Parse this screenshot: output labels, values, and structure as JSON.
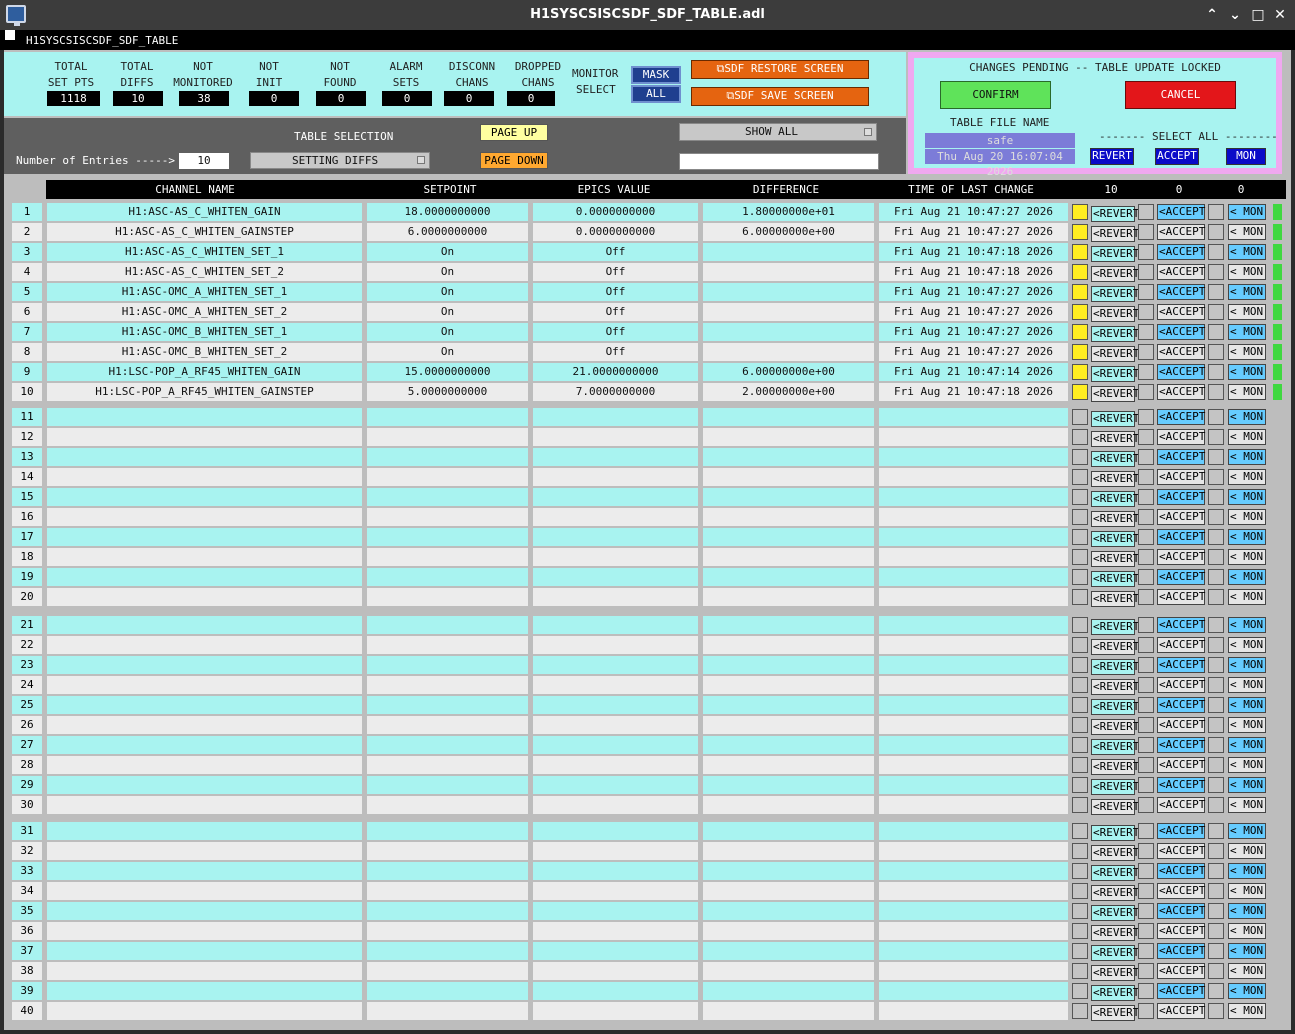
{
  "window": {
    "title": "H1SYSCSISCSDF_SDF_TABLE.adl",
    "minimize": "⌃",
    "restore": "⌄",
    "maximize": "□",
    "close": "✕"
  },
  "menubar": {
    "label": "H1SYSCSISCSDF_SDF_TABLE"
  },
  "stats": [
    {
      "label1": "TOTAL",
      "label2": "SET PTS",
      "value": "1118"
    },
    {
      "label1": "TOTAL",
      "label2": "DIFFS",
      "value": "10"
    },
    {
      "label1": "NOT",
      "label2": "MONITORED",
      "value": "38"
    },
    {
      "label1": "NOT",
      "label2": "INIT",
      "value": "0"
    },
    {
      "label1": "NOT",
      "label2": "FOUND",
      "value": "0"
    },
    {
      "label1": "ALARM",
      "label2": "SETS",
      "value": "0"
    },
    {
      "label1": "DISCONN",
      "label2": "CHANS",
      "value": "0"
    },
    {
      "label1": "DROPPED",
      "label2": "CHANS",
      "value": "0"
    }
  ],
  "monitor_select": {
    "label1": "MONITOR",
    "label2": "SELECT",
    "mask": "MASK",
    "all": "ALL"
  },
  "restore_button": "⧉SDF RESTORE SCREEN",
  "save_button": "⧉SDF SAVE SCREEN",
  "pending": {
    "title": "CHANGES PENDING -- TABLE UPDATE LOCKED",
    "confirm": "CONFIRM",
    "cancel": "CANCEL",
    "table_file_label": "TABLE FILE NAME",
    "table_file": "safe",
    "timestamp": "Thu Aug 20 16:07:04 2026",
    "select_all": "------- SELECT ALL --------",
    "revert": "REVERT",
    "accept": "ACCEPT",
    "mon": "MON"
  },
  "controls": {
    "entries_label": "Number of Entries ----->",
    "entries_value": "10",
    "table_selection_label": "TABLE SELECTION",
    "table_selection_value": "SETTING DIFFS",
    "page_up": "PAGE UP",
    "page_down": "PAGE DOWN",
    "show_all": "SHOW ALL",
    "filter_value": ""
  },
  "table_header": {
    "channel": "CHANNEL NAME",
    "setpoint": "SETPOINT",
    "epics": "EPICS VALUE",
    "difference": "DIFFERENCE",
    "time": "TIME OF LAST CHANGE",
    "count_revert": "10",
    "count_accept": "0",
    "count_mon": "0"
  },
  "row_buttons": {
    "revert": "<REVERT",
    "accept": "<ACCEPT",
    "mon": "< MON"
  },
  "rows": [
    {
      "n": "1",
      "channel": "H1:ASC-AS_C_WHITEN_GAIN",
      "setpoint": "18.0000000000",
      "epics": "0.0000000000",
      "diff": "1.80000000e+01",
      "time": "Fri Aug 21 10:47:27 2026"
    },
    {
      "n": "2",
      "channel": "H1:ASC-AS_C_WHITEN_GAINSTEP",
      "setpoint": "6.0000000000",
      "epics": "0.0000000000",
      "diff": "6.00000000e+00",
      "time": "Fri Aug 21 10:47:27 2026"
    },
    {
      "n": "3",
      "channel": "H1:ASC-AS_C_WHITEN_SET_1",
      "setpoint": "On",
      "epics": "Off",
      "diff": "",
      "time": "Fri Aug 21 10:47:18 2026"
    },
    {
      "n": "4",
      "channel": "H1:ASC-AS_C_WHITEN_SET_2",
      "setpoint": "On",
      "epics": "Off",
      "diff": "",
      "time": "Fri Aug 21 10:47:18 2026"
    },
    {
      "n": "5",
      "channel": "H1:ASC-OMC_A_WHITEN_SET_1",
      "setpoint": "On",
      "epics": "Off",
      "diff": "",
      "time": "Fri Aug 21 10:47:27 2026"
    },
    {
      "n": "6",
      "channel": "H1:ASC-OMC_A_WHITEN_SET_2",
      "setpoint": "On",
      "epics": "Off",
      "diff": "",
      "time": "Fri Aug 21 10:47:27 2026"
    },
    {
      "n": "7",
      "channel": "H1:ASC-OMC_B_WHITEN_SET_1",
      "setpoint": "On",
      "epics": "Off",
      "diff": "",
      "time": "Fri Aug 21 10:47:27 2026"
    },
    {
      "n": "8",
      "channel": "H1:ASC-OMC_B_WHITEN_SET_2",
      "setpoint": "On",
      "epics": "Off",
      "diff": "",
      "time": "Fri Aug 21 10:47:27 2026"
    },
    {
      "n": "9",
      "channel": "H1:LSC-POP_A_RF45_WHITEN_GAIN",
      "setpoint": "15.0000000000",
      "epics": "21.0000000000",
      "diff": "6.00000000e+00",
      "time": "Fri Aug 21 10:47:14 2026"
    },
    {
      "n": "10",
      "channel": "H1:LSC-POP_A_RF45_WHITEN_GAINSTEP",
      "setpoint": "5.0000000000",
      "epics": "7.0000000000",
      "diff": "2.00000000e+00",
      "time": "Fri Aug 21 10:47:18 2026"
    },
    {
      "n": "11",
      "channel": "",
      "setpoint": "",
      "epics": "",
      "diff": "",
      "time": ""
    },
    {
      "n": "12",
      "channel": "",
      "setpoint": "",
      "epics": "",
      "diff": "",
      "time": ""
    },
    {
      "n": "13",
      "channel": "",
      "setpoint": "",
      "epics": "",
      "diff": "",
      "time": ""
    },
    {
      "n": "14",
      "channel": "",
      "setpoint": "",
      "epics": "",
      "diff": "",
      "time": ""
    },
    {
      "n": "15",
      "channel": "",
      "setpoint": "",
      "epics": "",
      "diff": "",
      "time": ""
    },
    {
      "n": "16",
      "channel": "",
      "setpoint": "",
      "epics": "",
      "diff": "",
      "time": ""
    },
    {
      "n": "17",
      "channel": "",
      "setpoint": "",
      "epics": "",
      "diff": "",
      "time": ""
    },
    {
      "n": "18",
      "channel": "",
      "setpoint": "",
      "epics": "",
      "diff": "",
      "time": ""
    },
    {
      "n": "19",
      "channel": "",
      "setpoint": "",
      "epics": "",
      "diff": "",
      "time": ""
    },
    {
      "n": "20",
      "channel": "",
      "setpoint": "",
      "epics": "",
      "diff": "",
      "time": ""
    },
    {
      "n": "21",
      "channel": "",
      "setpoint": "",
      "epics": "",
      "diff": "",
      "time": ""
    },
    {
      "n": "22",
      "channel": "",
      "setpoint": "",
      "epics": "",
      "diff": "",
      "time": ""
    },
    {
      "n": "23",
      "channel": "",
      "setpoint": "",
      "epics": "",
      "diff": "",
      "time": ""
    },
    {
      "n": "24",
      "channel": "",
      "setpoint": "",
      "epics": "",
      "diff": "",
      "time": ""
    },
    {
      "n": "25",
      "channel": "",
      "setpoint": "",
      "epics": "",
      "diff": "",
      "time": ""
    },
    {
      "n": "26",
      "channel": "",
      "setpoint": "",
      "epics": "",
      "diff": "",
      "time": ""
    },
    {
      "n": "27",
      "channel": "",
      "setpoint": "",
      "epics": "",
      "diff": "",
      "time": ""
    },
    {
      "n": "28",
      "channel": "",
      "setpoint": "",
      "epics": "",
      "diff": "",
      "time": ""
    },
    {
      "n": "29",
      "channel": "",
      "setpoint": "",
      "epics": "",
      "diff": "",
      "time": ""
    },
    {
      "n": "30",
      "channel": "",
      "setpoint": "",
      "epics": "",
      "diff": "",
      "time": ""
    },
    {
      "n": "31",
      "channel": "",
      "setpoint": "",
      "epics": "",
      "diff": "",
      "time": ""
    },
    {
      "n": "32",
      "channel": "",
      "setpoint": "",
      "epics": "",
      "diff": "",
      "time": ""
    },
    {
      "n": "33",
      "channel": "",
      "setpoint": "",
      "epics": "",
      "diff": "",
      "time": ""
    },
    {
      "n": "34",
      "channel": "",
      "setpoint": "",
      "epics": "",
      "diff": "",
      "time": ""
    },
    {
      "n": "35",
      "channel": "",
      "setpoint": "",
      "epics": "",
      "diff": "",
      "time": ""
    },
    {
      "n": "36",
      "channel": "",
      "setpoint": "",
      "epics": "",
      "diff": "",
      "time": ""
    },
    {
      "n": "37",
      "channel": "",
      "setpoint": "",
      "epics": "",
      "diff": "",
      "time": ""
    },
    {
      "n": "38",
      "channel": "",
      "setpoint": "",
      "epics": "",
      "diff": "",
      "time": ""
    },
    {
      "n": "39",
      "channel": "",
      "setpoint": "",
      "epics": "",
      "diff": "",
      "time": ""
    },
    {
      "n": "40",
      "channel": "",
      "setpoint": "",
      "epics": "",
      "diff": "",
      "time": ""
    }
  ],
  "colors": {
    "cyan": "#a8f3f0",
    "gray_row": "#ececec",
    "yellow": "#ffee22",
    "green": "#3fd840",
    "orange": "#e56410",
    "confirm": "#5fe35a",
    "cancel": "#e3161a"
  }
}
